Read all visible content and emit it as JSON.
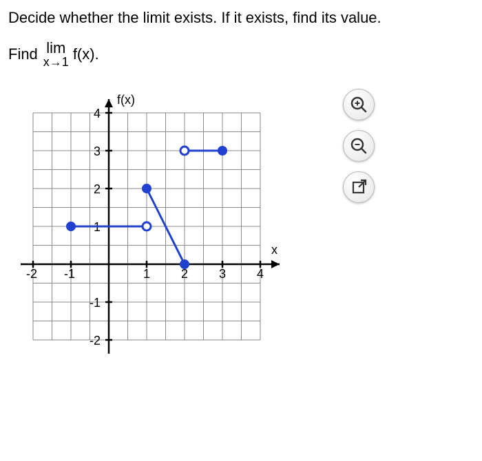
{
  "question": "Decide whether the limit exists. If it exists, find its value.",
  "find_label": "Find",
  "limit_top": "lim",
  "limit_bottom": "x→1",
  "fx_text": "f(x).",
  "graph": {
    "y_axis_label": "f(x)",
    "x_axis_label": "x",
    "x_ticks": [
      "-2",
      "-1",
      "1",
      "2",
      "3",
      "4"
    ],
    "y_ticks_pos": [
      "4",
      "3",
      "2"
    ],
    "y_ticks_neg": [
      "-1",
      "-2"
    ],
    "y_tick_1": "1"
  },
  "chart_data": {
    "type": "piecewise-line",
    "xlabel": "x",
    "ylabel": "f(x)",
    "x_range": [
      -2,
      4
    ],
    "y_range": [
      -2,
      4
    ],
    "segments": [
      {
        "points": [
          {
            "x": -1,
            "y": 1,
            "type": "closed"
          },
          {
            "x": 1,
            "y": 1,
            "type": "open"
          }
        ]
      },
      {
        "points": [
          {
            "x": 1,
            "y": 2,
            "type": "closed"
          },
          {
            "x": 2,
            "y": 0,
            "type": "closed"
          }
        ]
      },
      {
        "points": [
          {
            "x": 2,
            "y": 3,
            "type": "open"
          },
          {
            "x": 3,
            "y": 3,
            "type": "closed"
          }
        ]
      }
    ]
  },
  "tools": {
    "zoom_in": "zoom-in",
    "zoom_out": "zoom-out",
    "popout": "popout"
  }
}
